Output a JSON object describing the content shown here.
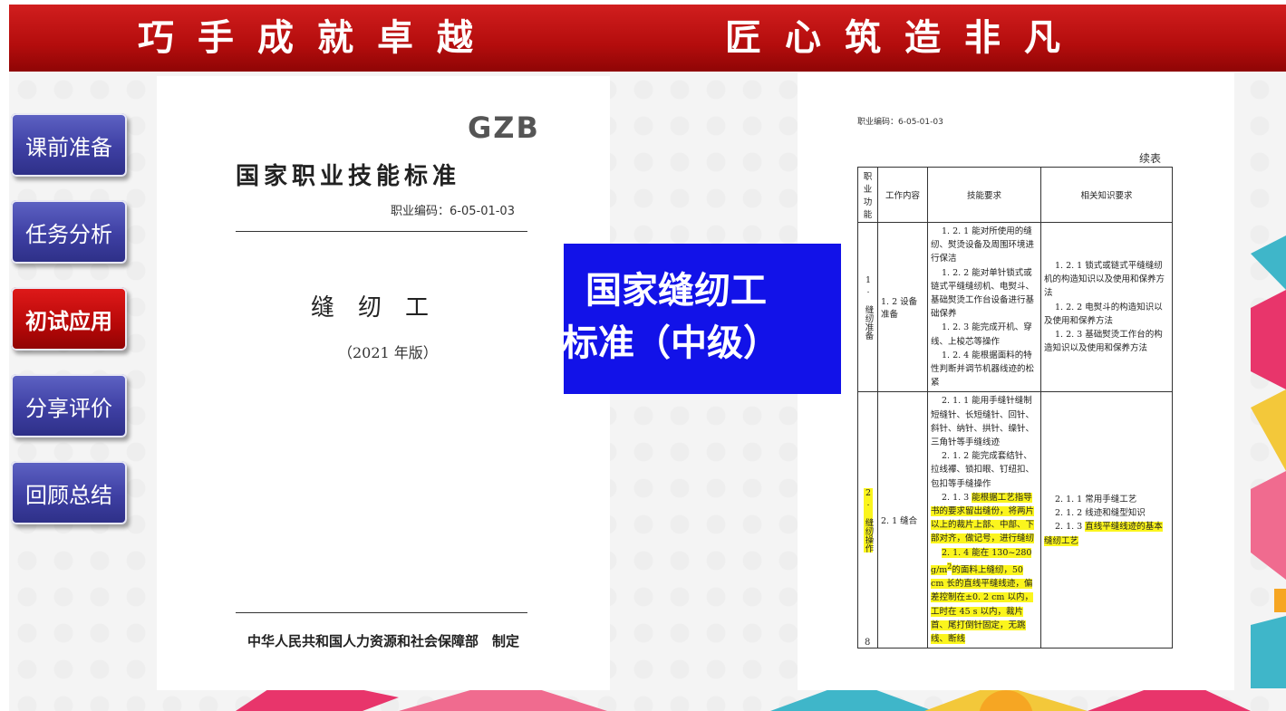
{
  "banner": {
    "left": "巧手成就卓越",
    "right": "匠心筑造非凡"
  },
  "nav": [
    {
      "label": "课前准备",
      "active": false
    },
    {
      "label": "任务分析",
      "active": false
    },
    {
      "label": "初试应用",
      "active": true
    },
    {
      "label": "分享评价",
      "active": false
    },
    {
      "label": "回顾总结",
      "active": false
    }
  ],
  "page1": {
    "logo": "GZB",
    "title": "国家职业技能标准",
    "code": "职业编码：6-05-01-03",
    "job": "缝纫工",
    "edition": "（2021 年版）",
    "org": "中华人民共和国人力资源和社会保障部　制定"
  },
  "overlay": {
    "line1": "国家缝纫工",
    "line2": "标准（中级）"
  },
  "page2": {
    "code": "职业编码：6-05-01-03",
    "continued": "续表",
    "headers": [
      "职业功能",
      "工作内容",
      "技能要求",
      "相关知识要求"
    ],
    "row1": {
      "function": "1. 缝纫准备",
      "content": "1. 2 设备准备",
      "skills": [
        "1. 2. 1 能对所使用的缝纫、熨烫设备及周围环境进行保洁",
        "1. 2. 2 能对单针锁式或链式平缝缝纫机、电熨斗、基础熨烫工作台设备进行基础保养",
        "1. 2. 3 能完成开机、穿线、上梭芯等操作",
        "1. 2. 4 能根据面料的特性判断并调节机器线迹的松紧"
      ],
      "knowledge": [
        "1. 2. 1 锁式或链式平缝缝纫机的构造知识以及使用和保养方法",
        "1. 2. 2 电熨斗的构造知识以及使用和保养方法",
        "1. 2. 3 基础熨烫工作台的构造知识以及使用和保养方法"
      ]
    },
    "row2": {
      "function": "2. 缝纫操作",
      "content": "2. 1 缝合",
      "skills": {
        "s1": "2. 1. 1 能用手缝针缝制短缝针、长短缝针、回针、斜针、纳针、拱针、缲针、三角针等手缝线迹",
        "s2": "2. 1. 2 能完成套结针、拉线襻、锁扣眼、钉纽扣、包扣等手缝操作",
        "s3_pre": "2. 1. 3 ",
        "s3_hl": "能根据工艺指导书的要求留出缝份，将两片以上的裁片上部、中部、下部对齐，做记号，进行缝纫",
        "s4_pre": "2. 1. 4 能在 130~280 g/m",
        "s4_sup": "2",
        "s4_hl": "的面料上缝纫，50 cm 长的直线平缝线迹，偏差控制在±0. 2 cm 以内，工时在 45 s 以内，裁片首、尾打倒针固定，无跳线、断线"
      },
      "knowledge": {
        "k1": "2. 1. 1 常用手缝工艺",
        "k2": "2. 1. 2 线迹和缝型知识",
        "k3_pre": "2. 1. 3 ",
        "k3_hl": "直线平缝线迹的基本缝纫工艺"
      }
    },
    "page_number": "8"
  }
}
